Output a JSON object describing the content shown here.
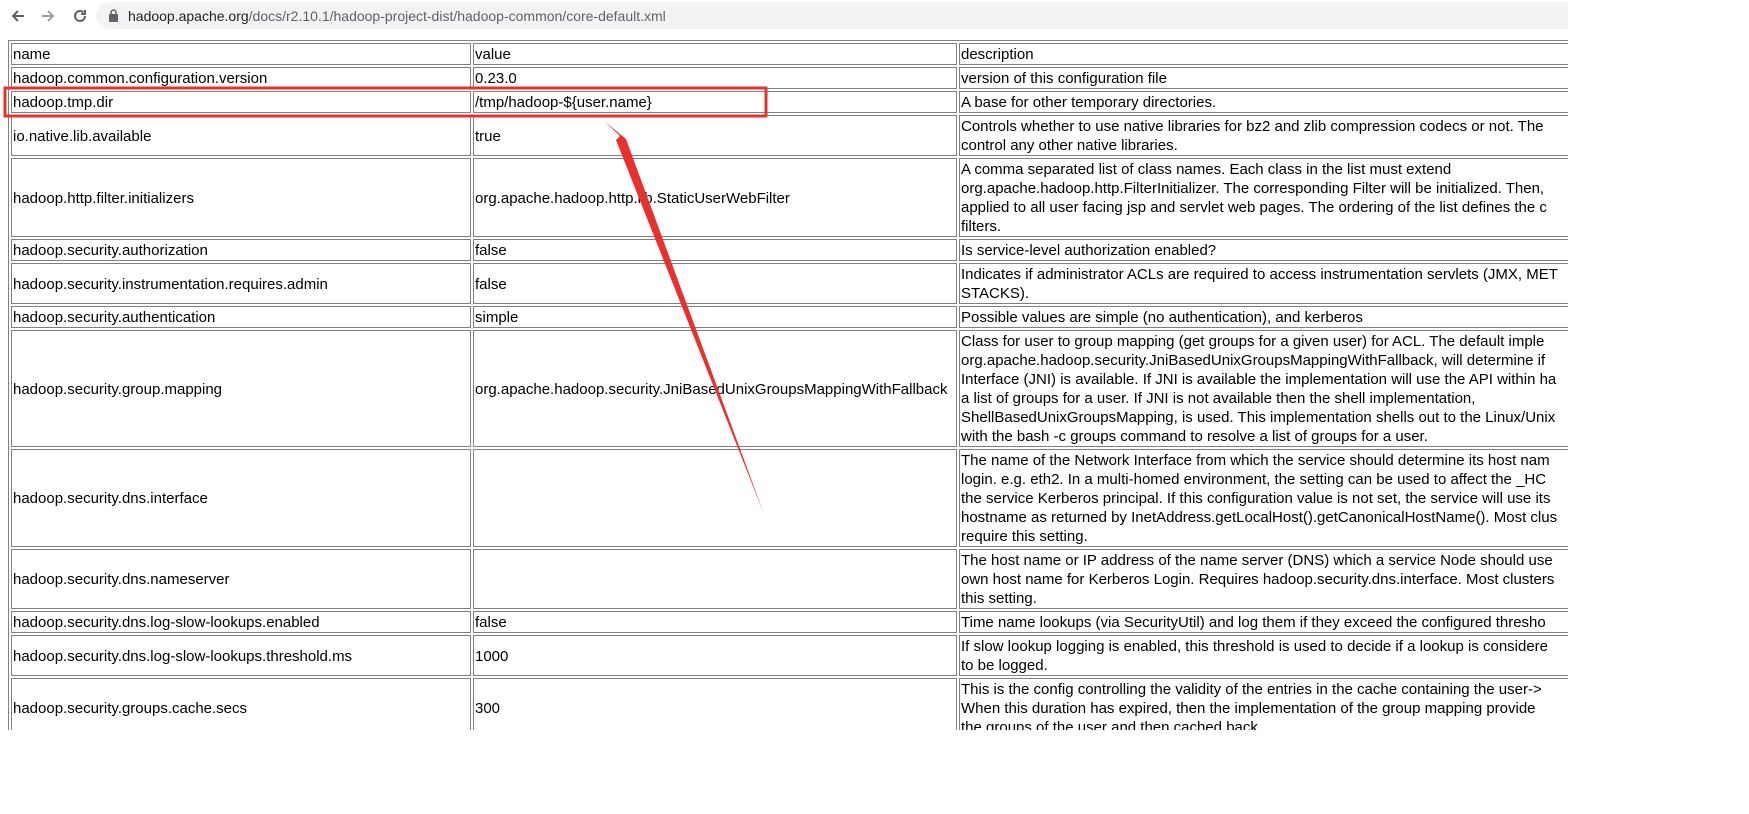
{
  "browser": {
    "url_host": "hadoop.apache.org",
    "url_path": "/docs/r2.10.1/hadoop-project-dist/hadoop-common/core-default.xml",
    "icons": [
      "back-arrow-icon",
      "forward-arrow-icon",
      "reload-icon",
      "lock-icon"
    ]
  },
  "table": {
    "headers": {
      "name": "name",
      "value": "value",
      "description": "description"
    },
    "rows": [
      {
        "name": "hadoop.common.configuration.version",
        "value": "0.23.0",
        "desc": [
          "version of this configuration file"
        ]
      },
      {
        "name": "hadoop.tmp.dir",
        "value": "/tmp/hadoop-${user.name}",
        "desc": [
          "A base for other temporary directories."
        ]
      },
      {
        "name": "io.native.lib.available",
        "value": "true",
        "desc": [
          "Controls whether to use native libraries for bz2 and zlib compression codecs or not. The",
          "control any other native libraries."
        ]
      },
      {
        "name": "hadoop.http.filter.initializers",
        "value": "org.apache.hadoop.http.lib.StaticUserWebFilter",
        "desc": [
          "A comma separated list of class names. Each class in the list must extend",
          "org.apache.hadoop.http.FilterInitializer. The corresponding Filter will be initialized. Then,",
          "applied to all user facing jsp and servlet web pages. The ordering of the list defines the c",
          "filters."
        ]
      },
      {
        "name": "hadoop.security.authorization",
        "value": "false",
        "desc": [
          "Is service-level authorization enabled?"
        ]
      },
      {
        "name": "hadoop.security.instrumentation.requires.admin",
        "value": "false",
        "desc": [
          "Indicates if administrator ACLs are required to access instrumentation servlets (JMX, MET",
          "STACKS)."
        ]
      },
      {
        "name": "hadoop.security.authentication",
        "value": "simple",
        "desc": [
          "Possible values are simple (no authentication), and kerberos"
        ]
      },
      {
        "name": "hadoop.security.group.mapping",
        "value": "org.apache.hadoop.security.JniBasedUnixGroupsMappingWithFallback",
        "desc": [
          "Class for user to group mapping (get groups for a given user) for ACL. The default imple",
          "org.apache.hadoop.security.JniBasedUnixGroupsMappingWithFallback, will determine if",
          "Interface (JNI) is available. If JNI is available the implementation will use the API within ha",
          "a list of groups for a user. If JNI is not available then the shell implementation,",
          "ShellBasedUnixGroupsMapping, is used. This implementation shells out to the Linux/Unix",
          "with the bash -c groups command to resolve a list of groups for a user."
        ]
      },
      {
        "name": "hadoop.security.dns.interface",
        "value": "",
        "desc": [
          "The name of the Network Interface from which the service should determine its host nam",
          "login. e.g. eth2. In a multi-homed environment, the setting can be used to affect the _HC",
          "the service Kerberos principal. If this configuration value is not set, the service will use its",
          "hostname as returned by InetAddress.getLocalHost().getCanonicalHostName(). Most clus",
          "require this setting."
        ]
      },
      {
        "name": "hadoop.security.dns.nameserver",
        "value": "",
        "desc": [
          "The host name or IP address of the name server (DNS) which a service Node should use",
          "own host name for Kerberos Login. Requires hadoop.security.dns.interface. Most clusters",
          "this setting."
        ]
      },
      {
        "name": "hadoop.security.dns.log-slow-lookups.enabled",
        "value": "false",
        "desc": [
          "Time name lookups (via SecurityUtil) and log them if they exceed the configured thresho"
        ]
      },
      {
        "name": "hadoop.security.dns.log-slow-lookups.threshold.ms",
        "value": "1000",
        "desc": [
          "If slow lookup logging is enabled, this threshold is used to decide if a lookup is considere",
          "to be logged."
        ]
      },
      {
        "name": "hadoop.security.groups.cache.secs",
        "value": "300",
        "desc": [
          "This is the config controlling the validity of the entries in the cache containing the user->",
          "When this duration has expired, then the implementation of the group mapping provide",
          "the groups of the user and then cached back."
        ]
      }
    ]
  },
  "annotation": {
    "highlight_color": "#e8312f",
    "arrow_color": "#e8312f"
  }
}
